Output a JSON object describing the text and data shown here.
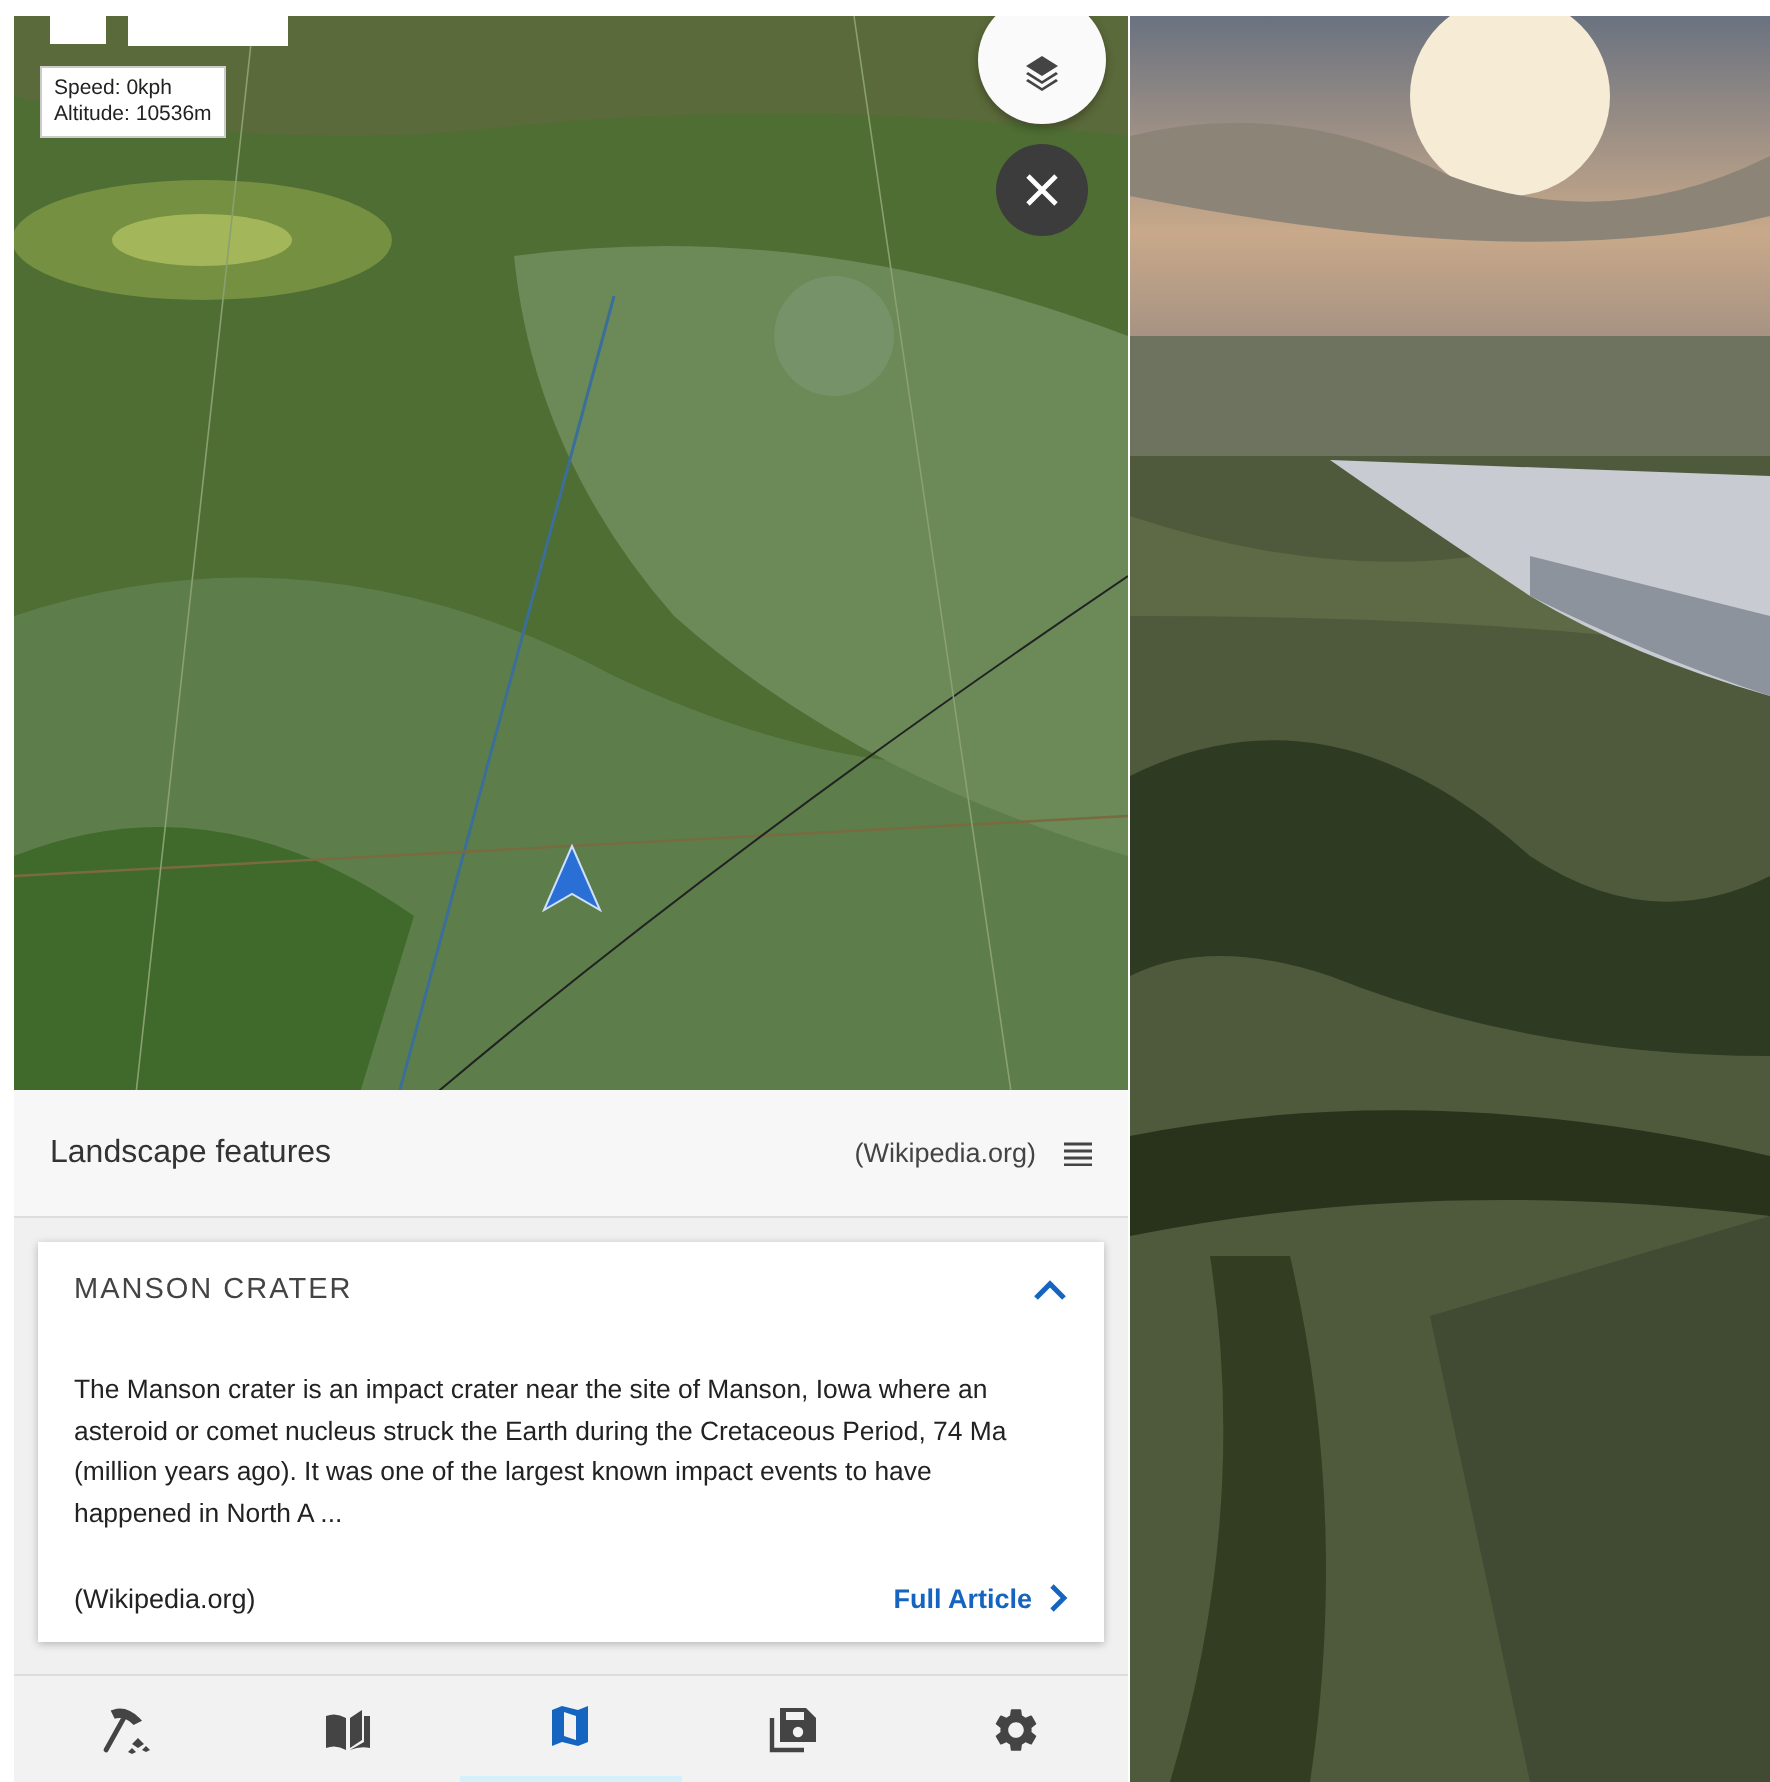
{
  "map_overlay": {
    "speed": "Speed: 0kph",
    "altitude": "Altitude: 10536m"
  },
  "panel": {
    "title": "Landscape features",
    "source": "(Wikipedia.org)"
  },
  "card": {
    "title": "MANSON CRATER",
    "expanded": true,
    "body": "The Manson crater is an impact crater near the site of Manson, Iowa where an asteroid or comet nucleus struck the Earth during the Cretaceous Period, 74 Ma (million years ago). It was one of the largest known impact events to have happened in North A ...",
    "source": "(Wikipedia.org)",
    "link": "Full Article"
  },
  "nav": [
    {
      "kind": "geology",
      "selected": false
    },
    {
      "kind": "book",
      "selected": false
    },
    {
      "kind": "map",
      "selected": true
    },
    {
      "kind": "saved",
      "selected": false
    },
    {
      "kind": "settings",
      "selected": false
    }
  ]
}
